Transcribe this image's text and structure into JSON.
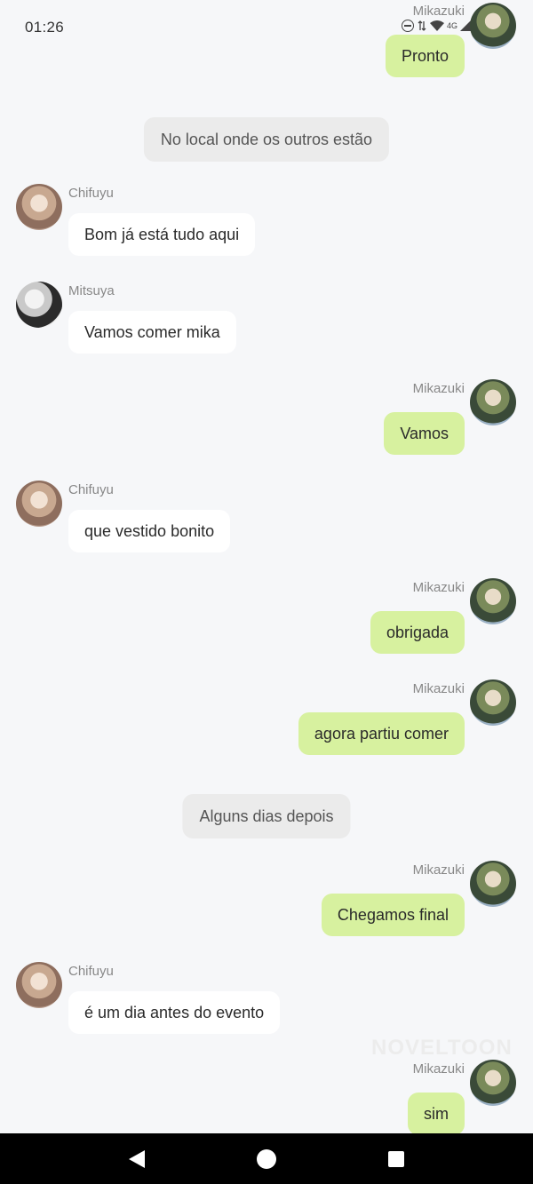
{
  "status_bar": {
    "time": "01:26",
    "network": "4G"
  },
  "characters": {
    "mikazuki": "Mikazuki",
    "chifuyu": "Chifuyu",
    "mitsuya": "Mitsuya"
  },
  "messages": [
    {
      "speaker": "Mikazuki",
      "side": "right",
      "text": "Pronto"
    },
    {
      "type": "narration",
      "text": "No local onde os outros estão"
    },
    {
      "speaker": "Chifuyu",
      "side": "left",
      "text": "Bom já está tudo aqui"
    },
    {
      "speaker": "Mitsuya",
      "side": "left",
      "text": "Vamos comer mika"
    },
    {
      "speaker": "Mikazuki",
      "side": "right",
      "text": "Vamos"
    },
    {
      "speaker": "Chifuyu",
      "side": "left",
      "text": "que vestido bonito"
    },
    {
      "speaker": "Mikazuki",
      "side": "right",
      "text": "obrigada"
    },
    {
      "speaker": "Mikazuki",
      "side": "right",
      "text": "agora partiu comer"
    },
    {
      "type": "narration",
      "text": "Alguns dias depois"
    },
    {
      "speaker": "Mikazuki",
      "side": "right",
      "text": "Chegamos final"
    },
    {
      "speaker": "Chifuyu",
      "side": "left",
      "text": "é um dia antes do evento"
    },
    {
      "speaker": "Mikazuki",
      "side": "right",
      "text": "sim"
    }
  ],
  "watermark": "NOVELTOON",
  "icons": {
    "back": "back-icon",
    "home": "home-icon",
    "recents": "recents-icon"
  }
}
